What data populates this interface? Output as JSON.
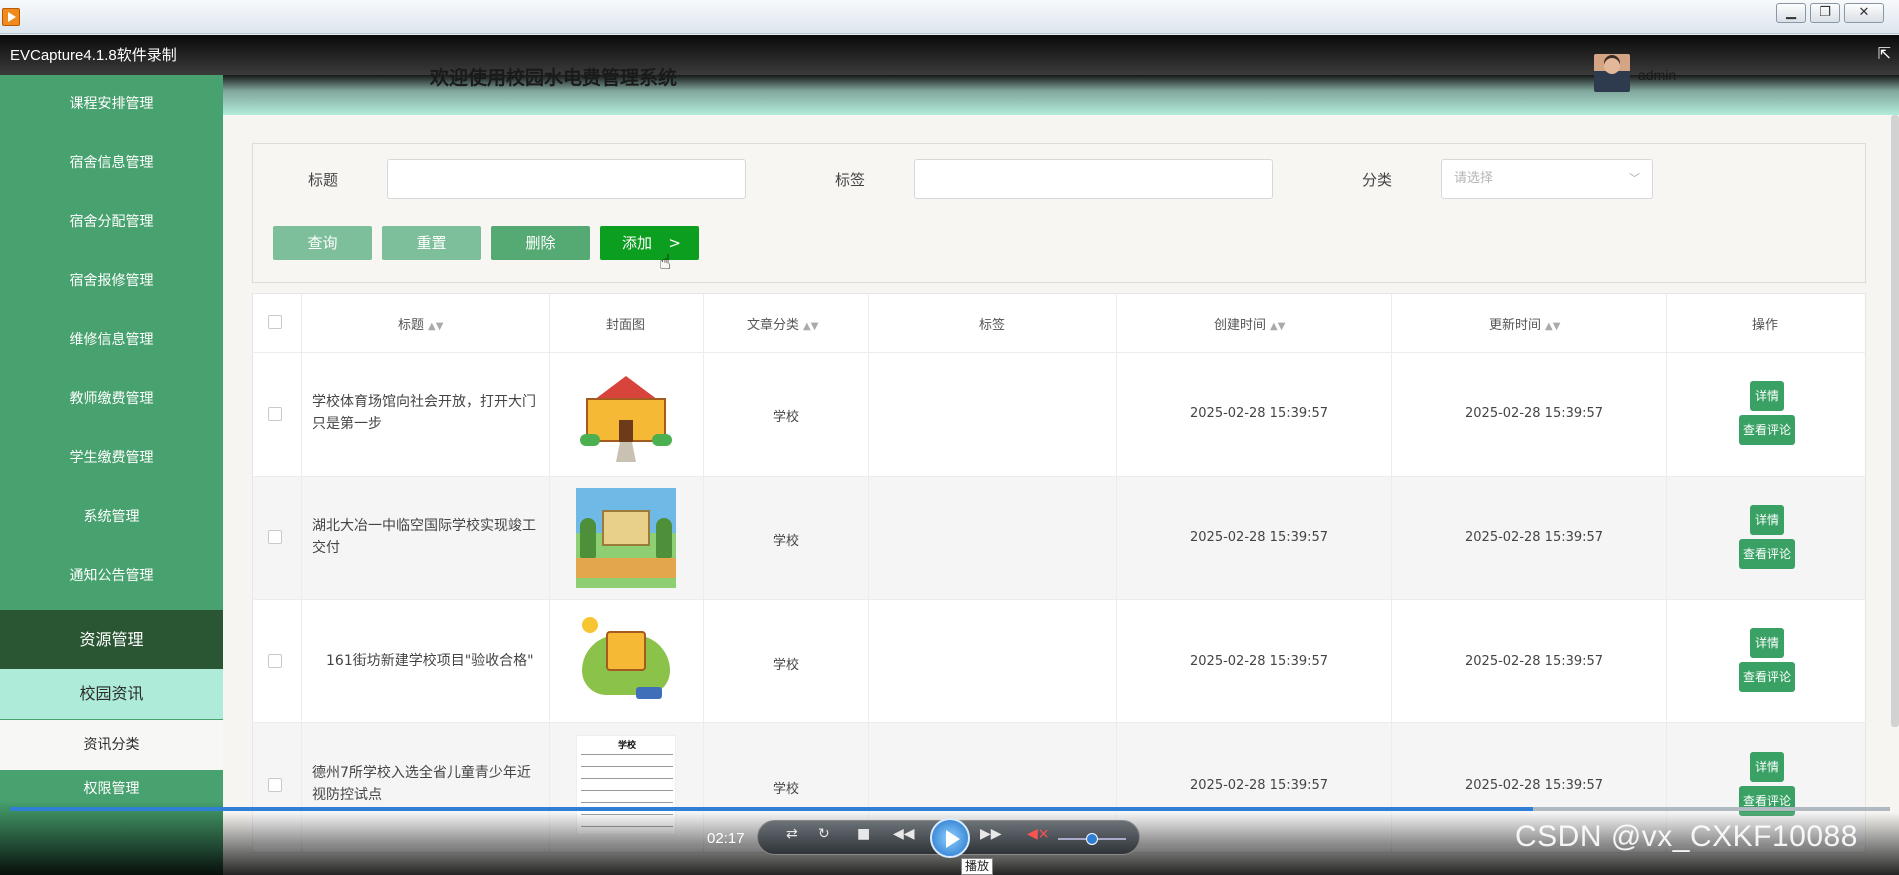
{
  "window": {
    "minimize": "▁",
    "restore": "❐",
    "close": "✕"
  },
  "capture_title": "EVCapture4.1.8软件录制",
  "header": {
    "title": "欢迎使用校园水电费管理系统",
    "user": "admin"
  },
  "sidebar": {
    "items": [
      {
        "label": "课程安排管理"
      },
      {
        "label": "宿舍信息管理"
      },
      {
        "label": "宿舍分配管理"
      },
      {
        "label": "宿舍报修管理"
      },
      {
        "label": "维修信息管理"
      },
      {
        "label": "教师缴费管理"
      },
      {
        "label": "学生缴费管理"
      },
      {
        "label": "系统管理"
      },
      {
        "label": "通知公告管理"
      },
      {
        "label": "资源管理"
      },
      {
        "label": "校园资讯"
      },
      {
        "label": "资讯分类"
      },
      {
        "label": "权限管理"
      }
    ]
  },
  "filter": {
    "title_label": "标题",
    "tag_label": "标签",
    "category_label": "分类",
    "category_placeholder": "请选择",
    "buttons": {
      "query": "查询",
      "reset": "重置",
      "delete": "删除",
      "add": "添加",
      "add_arrow": ">"
    }
  },
  "table": {
    "headers": [
      "标题",
      "封面图",
      "文章分类",
      "标签",
      "创建时间",
      "更新时间",
      "操作"
    ],
    "sort_icon": "▲▼",
    "rows": [
      {
        "title": "学校体育场馆向社会开放，打开大门只是第一步",
        "category": "学校",
        "tags": "",
        "created": "2025-02-28 15:39:57",
        "updated": "2025-02-28 15:39:57"
      },
      {
        "title": "湖北大冶一中临空国际学校实现竣工交付",
        "category": "学校",
        "tags": "",
        "created": "2025-02-28 15:39:57",
        "updated": "2025-02-28 15:39:57"
      },
      {
        "title": "161街坊新建学校项目\"验收合格\"",
        "category": "学校",
        "tags": "",
        "created": "2025-02-28 15:39:57",
        "updated": "2025-02-28 15:39:57"
      },
      {
        "title": "德州7所学校入选全省儿童青少年近视防控试点",
        "category": "学校",
        "tags": "",
        "created": "2025-02-28 15:39:57",
        "updated": "2025-02-28 15:39:57"
      }
    ],
    "ops": {
      "detail": "详情",
      "comments": "查看评论"
    },
    "thumb4_heading": "学校"
  },
  "player": {
    "time": "02:17",
    "tooltip": "播放",
    "progress_fraction": 0.81
  },
  "watermark": "CSDN @vx_CXKF10088",
  "icons": [
    "app-icon",
    "collapse-icon",
    "avatar",
    "chevron-down-icon",
    "sort-icon",
    "hand-cursor-icon",
    "play-icon",
    "stop-icon",
    "rewind-icon",
    "forward-icon",
    "mute-icon"
  ]
}
